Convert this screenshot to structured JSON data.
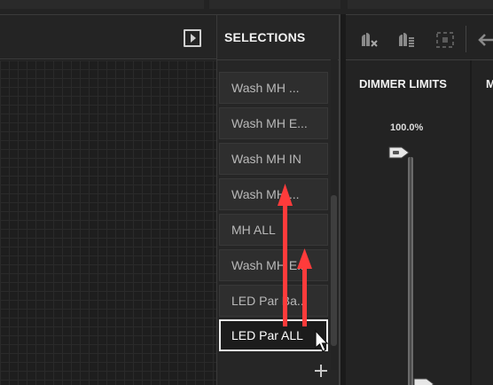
{
  "selections": {
    "title": "SELECTIONS",
    "items": [
      {
        "label": "Wash MH ..."
      },
      {
        "label": "Wash MH E..."
      },
      {
        "label": "Wash MH IN"
      },
      {
        "label": "Wash MH ..."
      },
      {
        "label": "MH ALL"
      },
      {
        "label": "Wash MH E..."
      },
      {
        "label": "LED Par Ba..."
      },
      {
        "label": "LED Par ALL"
      }
    ],
    "active_index": 7
  },
  "dimmer": {
    "title": "DIMMER LIMITS",
    "value": "100.0%",
    "next_column_title": "M"
  },
  "icons": {
    "panel_toggle": "panel-collapse-icon",
    "toolbar": [
      "mute-fixtures-icon",
      "highlight-fixtures-icon",
      "select-region-icon",
      "back-arrow-icon"
    ],
    "add": "plus-icon",
    "cursor": "mouse-pointer-icon"
  },
  "colors": {
    "accent_arrow": "#ff3b3b",
    "background": "#1b1b1b"
  }
}
